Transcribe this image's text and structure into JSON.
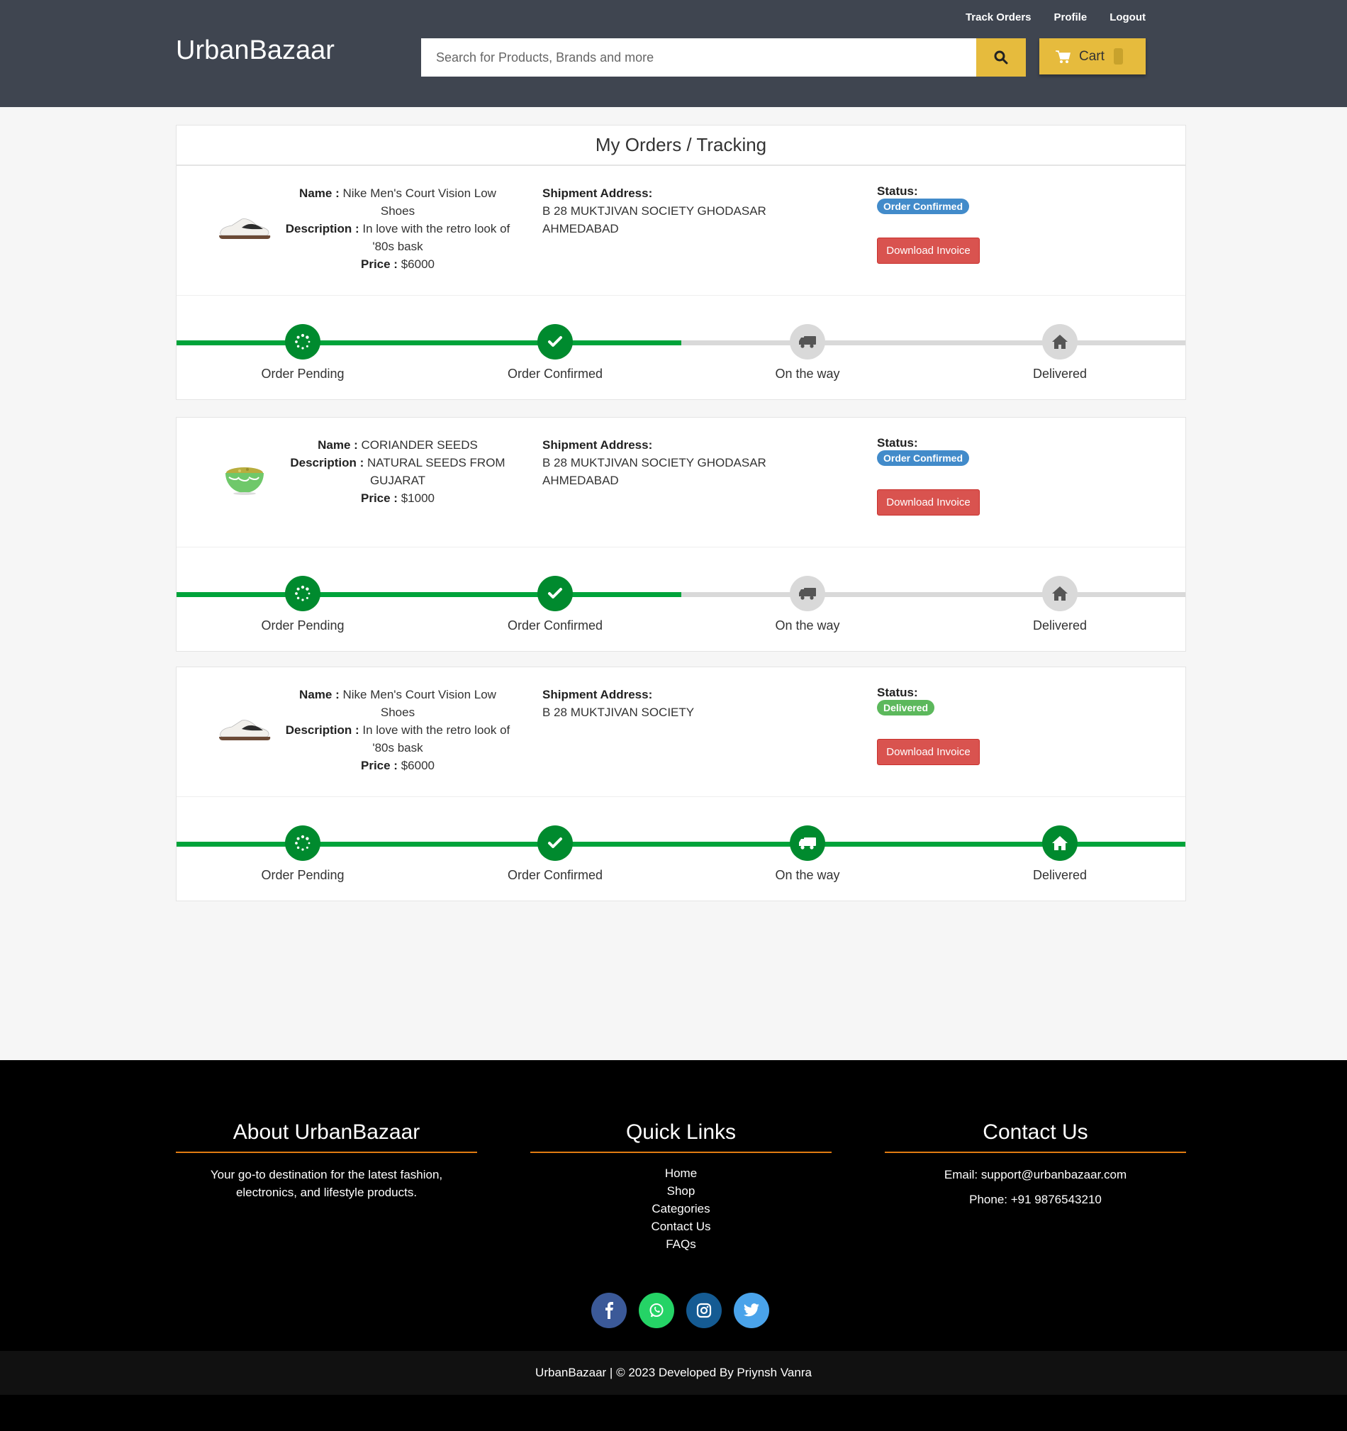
{
  "header": {
    "logo": "UrbanBazaar",
    "nav": [
      "Track Orders",
      "Profile",
      "Logout"
    ],
    "search_placeholder": "Search for Products, Brands and more",
    "cart_label": "Cart"
  },
  "page_title": "My Orders / Tracking",
  "labels": {
    "name": "Name :",
    "description": "Description :",
    "price": "Price :",
    "shipment": "Shipment Address:",
    "status": "Status:",
    "invoice": "Download Invoice"
  },
  "track_steps": [
    "Order Pending",
    "Order Confirmed",
    "On the way",
    "Delivered"
  ],
  "orders": [
    {
      "image": "sneaker",
      "name": "Nike Men's Court Vision Low Shoes",
      "description": "In love with the retro look of '80s bask",
      "price": "$6000",
      "address": "B 28 MUKTJIVAN SOCIETY GHODASAR AHMEDABAD",
      "status": "Order Confirmed",
      "status_color": "#428bca",
      "progress_steps_done": 2
    },
    {
      "image": "seed-bowl",
      "name": "CORIANDER SEEDS",
      "description": "NATURAL SEEDS FROM GUJARAT",
      "price": "$1000",
      "address": "B 28 MUKTJIVAN SOCIETY GHODASAR AHMEDABAD",
      "status": "Order Confirmed",
      "status_color": "#428bca",
      "progress_steps_done": 2
    },
    {
      "image": "sneaker",
      "name": "Nike Men's Court Vision Low Shoes",
      "description": "In love with the retro look of '80s bask",
      "price": "$6000",
      "address": "B 28 MUKTJIVAN SOCIETY",
      "status": "Delivered",
      "status_color": "#5cb85c",
      "progress_steps_done": 4
    }
  ],
  "footer": {
    "about_title": "About UrbanBazaar",
    "about_text": "Your go-to destination for the latest fashion, electronics, and lifestyle products.",
    "links_title": "Quick Links",
    "links": [
      "Home",
      "Shop",
      "Categories",
      "Contact Us",
      "FAQs"
    ],
    "contact_title": "Contact Us",
    "email": "Email: support@urbanbazaar.com",
    "phone": "Phone: +91 9876543210",
    "social": [
      "facebook-icon",
      "whatsapp-icon",
      "instagram-icon",
      "twitter-icon"
    ],
    "copyright": "UrbanBazaar | © 2023 Developed By Priynsh Vanra"
  },
  "colors": {
    "header_bg": "#3f4550",
    "accent": "#e6bb3d",
    "progress_done": "#008a2e",
    "invoice_button": "#d9534f",
    "footer_rule": "#e07b12"
  }
}
